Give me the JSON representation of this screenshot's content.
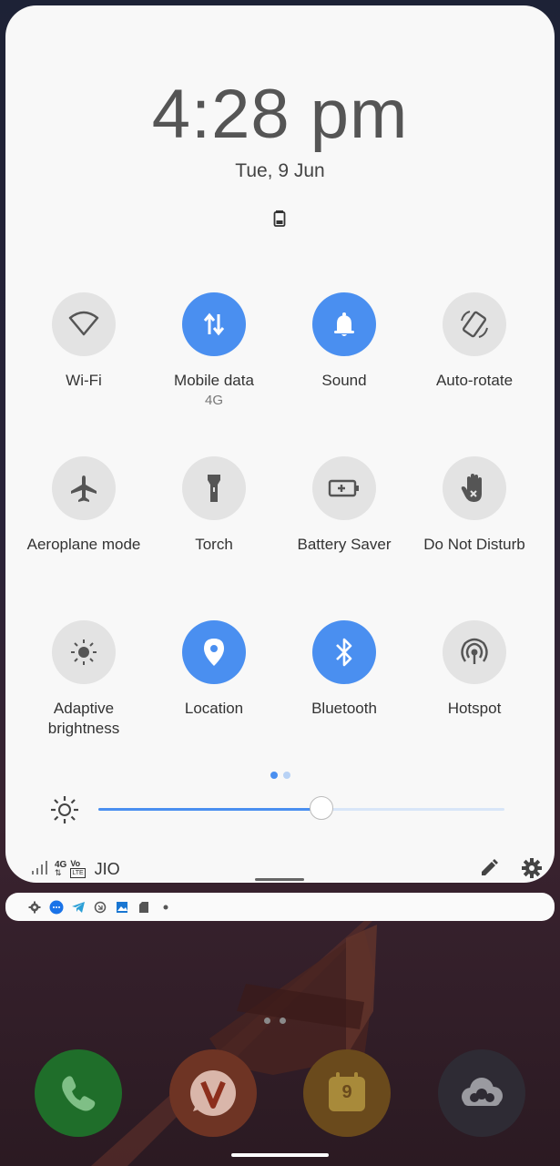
{
  "clock": {
    "time": "4:28 pm",
    "date": "Tue, 9 Jun"
  },
  "tiles": [
    {
      "label": "Wi-Fi",
      "sub": "",
      "active": false,
      "icon": "wifi-icon"
    },
    {
      "label": "Mobile data",
      "sub": "4G",
      "active": true,
      "icon": "mobile-data-icon"
    },
    {
      "label": "Sound",
      "sub": "",
      "active": true,
      "icon": "bell-icon"
    },
    {
      "label": "Auto-rotate",
      "sub": "",
      "active": false,
      "icon": "auto-rotate-icon"
    },
    {
      "label": "Aeroplane mode",
      "sub": "",
      "active": false,
      "icon": "airplane-icon"
    },
    {
      "label": "Torch",
      "sub": "",
      "active": false,
      "icon": "torch-icon"
    },
    {
      "label": "Battery Saver",
      "sub": "",
      "active": false,
      "icon": "battery-saver-icon"
    },
    {
      "label": "Do Not Disturb",
      "sub": "",
      "active": false,
      "icon": "do-not-disturb-icon"
    },
    {
      "label": "Adaptive brightness",
      "sub": "",
      "active": false,
      "icon": "adaptive-brightness-icon"
    },
    {
      "label": "Location",
      "sub": "",
      "active": true,
      "icon": "location-icon"
    },
    {
      "label": "Bluetooth",
      "sub": "",
      "active": true,
      "icon": "bluetooth-icon"
    },
    {
      "label": "Hotspot",
      "sub": "",
      "active": false,
      "icon": "hotspot-icon"
    }
  ],
  "brightness": {
    "level": 0.55
  },
  "status": {
    "carrier": "JIO",
    "network_label": "4G",
    "volte_label": "Vo",
    "lte_label": "LTE"
  },
  "colors": {
    "accent": "#4a8ff0",
    "tile_off": "#e3e3e3",
    "panel_bg": "#f8f8f8"
  },
  "notification_icons": [
    "settings-icon",
    "messages-icon",
    "telegram-icon",
    "sync-icon",
    "gallery-icon",
    "sd-card-icon",
    "more-dot-icon"
  ],
  "dock": [
    "phone-app-icon",
    "vivaldi-app-icon",
    "calendar-app-icon",
    "nextcloud-app-icon"
  ],
  "calendar_day": "9"
}
